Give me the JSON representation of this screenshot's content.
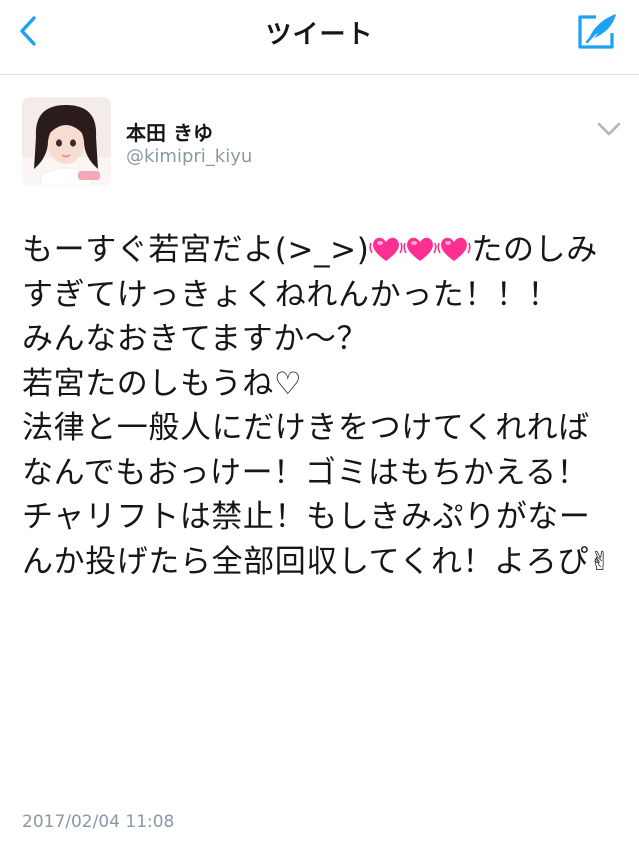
{
  "nav": {
    "title": "ツイート",
    "back_icon": "chevron-left-icon",
    "compose_icon": "compose-feather-icon",
    "accent": "#1da1f2"
  },
  "user": {
    "display_name": "本田 きゆ",
    "handle": "@kimipri_kiyu"
  },
  "tweet": {
    "part1": "もーすぐ若宮だよ(>_>)",
    "hearts": [
      "💓",
      "💓",
      "💓"
    ],
    "part2": "たのしみすぎてけっきょくねれんかった！！！\nみんなおきてますか〜？\n若宮たのしもうね♡\n法律と一般人にだけきをつけてくれればなんでもおっけー！ゴミはもちかえる！チャリフトは禁止！もしきみぷりがなーんか投げたら全部回収してくれ！よろぴ",
    "end_emoji": "✌"
  },
  "timestamp": "2017/02/04 11:08",
  "colors": {
    "heart": "#ff2f92",
    "secondary_text": "#8899a6",
    "divider": "#d9dde1"
  }
}
